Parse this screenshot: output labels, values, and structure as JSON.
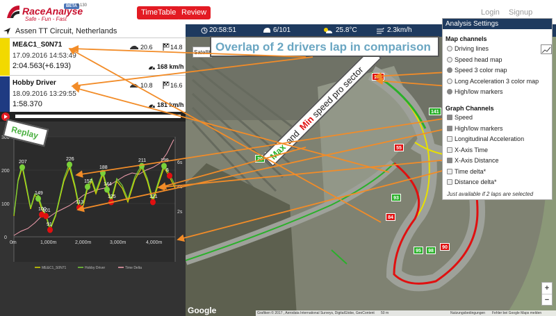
{
  "header": {
    "brand": "RaceAnalyse",
    "tagline": "Safe - Fun - Fast",
    "beta": "BETA",
    "version": "4.130",
    "timetable_label": "TimeTable",
    "review_label": "Review",
    "login_label": "Login",
    "signup_label": "Signup"
  },
  "track": {
    "name": "Assen TT Circuit, Netherlands"
  },
  "laps": [
    {
      "name": "ME&C1_S0N71",
      "date": "17.09.2016 14:53:49",
      "time": "2:04.563(+6.193)",
      "v1": "20.6",
      "v2": "14.8",
      "speed": "168 km/h",
      "color": "#f2d900"
    },
    {
      "name": "Hobby Driver",
      "date": "18.09.2016 13:29:55",
      "time": "1:58.370",
      "v1": "10.8",
      "v2": "16.6",
      "speed": "181 km/h",
      "color": "#1f3b82"
    }
  ],
  "replay": {
    "label": "Replay"
  },
  "graph": {
    "y_ticks": [
      "300",
      "200",
      "100",
      "0"
    ],
    "right_ticks": [
      "6s",
      "4s",
      "2s"
    ],
    "x_ticks": [
      "0m",
      "1,000m",
      "2,000m",
      "3,000m",
      "4,000m"
    ],
    "legend": [
      "ME&C1_S0N71",
      "Hobby Driver",
      "Time Delta"
    ],
    "labels": [
      "207",
      "149",
      "100",
      "101",
      "91",
      "226",
      "157",
      "113",
      "188",
      "144",
      "125",
      "211",
      "199",
      "121",
      "6"
    ]
  },
  "status": {
    "clock": "20:58:51",
    "laps": "6/101",
    "temp": "25.8°C",
    "wind": "2.3km/h"
  },
  "map": {
    "satellite_label": "Satellit",
    "banner": "Overlap of 2 drivers lap in comparison",
    "sector_label": {
      "max": "Max",
      "and": " and ",
      "min": "Min",
      "rest": " speed pro sector"
    },
    "markers": [
      "100",
      "141",
      "55",
      "93",
      "84",
      "95",
      "98",
      "90",
      "20",
      "20"
    ],
    "google": "Google",
    "attribution": {
      "credits": "Grafiken © 2017 , Aerodata International Surveys, DigitalGlobe, GeoContent",
      "scale": "50 m",
      "terms": "Nutzungsbedingungen",
      "report": "Fehler bei Google Maps melden"
    },
    "zoom_in": "+",
    "zoom_out": "−"
  },
  "settings": {
    "title": "Analysis Settings",
    "map_title": "Map channels",
    "map_options": [
      {
        "label": "Driving lines",
        "checked": false
      },
      {
        "label": "Speed head map",
        "checked": false
      },
      {
        "label": "Speed 3 color map",
        "checked": true
      },
      {
        "label": "Long Acceleration 3 color map",
        "checked": false
      },
      {
        "label": "High/low markers",
        "checked": true
      }
    ],
    "graph_title": "Graph Channels",
    "graph_options": [
      {
        "label": "Speed",
        "checked": true
      },
      {
        "label": "High/low markers",
        "checked": true
      },
      {
        "label": "Longitudinal Acceleration",
        "checked": false
      },
      {
        "label": "X-Axis Time",
        "checked": false
      },
      {
        "label": "X-Axis Distance",
        "checked": true
      },
      {
        "label": "Time delta*",
        "checked": false
      },
      {
        "label": "Distance delta*",
        "checked": false
      }
    ],
    "note": "Just available if 2 laps are selected"
  },
  "colors": {
    "accent": "#e31b23",
    "navy": "#1e3a5f",
    "annotation": "#f28c28",
    "lap1": "#f2d900",
    "lap2": "#1f3b82"
  }
}
